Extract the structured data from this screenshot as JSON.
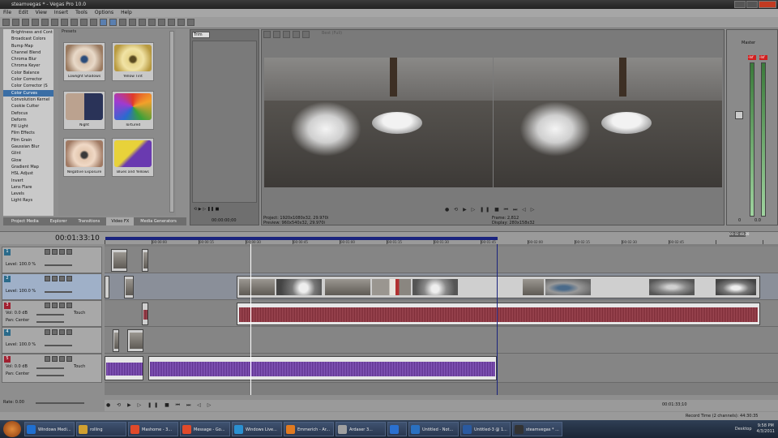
{
  "titlebar": {
    "title": "steamvegas * - Vegas Pro 10.0"
  },
  "menu": [
    "File",
    "Edit",
    "View",
    "Insert",
    "Tools",
    "Options",
    "Help"
  ],
  "fx_list": [
    "Brightness and Cont",
    "Broadcast Colors",
    "Bump Map",
    "Channel Blend",
    "Chroma Blur",
    "Chroma Keyer",
    "Color Balance",
    "Color Corrector",
    "Color Corrector (S",
    "Color Curves",
    "Convolution Kernel",
    "Cookie Cutter",
    "Defocus",
    "Deform",
    "Fill Light",
    "Film Effects",
    "Film Grain",
    "Gaussian Blur",
    "Glint",
    "Glow",
    "Gradient Map",
    "HSL Adjust",
    "Invert",
    "Lens Flare",
    "Levels",
    "Light Rays"
  ],
  "fx_selected_index": 9,
  "presets": {
    "header": "Presets",
    "items": [
      "Lowlight Shadows",
      "Yellow Tint",
      "Night",
      "Tortured",
      "Negative Exposure",
      "Blues and Yellows"
    ]
  },
  "tabs": [
    "Project Media",
    "Explorer",
    "Transitions",
    "Video FX",
    "Media Generators"
  ],
  "active_tab": "Video FX",
  "trimmer": {
    "dropdown": "Trim",
    "time": "00:00:00;00"
  },
  "preview": {
    "mode": "Best (Full)",
    "project_label": "Project:",
    "project_value": "1920x1080x32, 29.970i",
    "preview_label": "Preview:",
    "preview_value": "960x540x32, 29.970i",
    "frame_label": "Frame:",
    "frame_value": "2,812",
    "display_label": "Display:",
    "display_value": "280x158x32"
  },
  "mixer": {
    "title": "Master",
    "values": [
      "-Inf",
      "-Inf"
    ],
    "left_val": "0",
    "right_val": "0.0"
  },
  "timeline": {
    "timecode": "00:01:33:10",
    "ruler": [
      "00:00:00",
      "00:00:15",
      "00:00:30",
      "00:00:45",
      "00:01:00",
      "00:01:15",
      "00:01:30",
      "00:01:45",
      "00:02:00",
      "00:02:15",
      "00:02:30",
      "00:02:45"
    ],
    "tracks": [
      {
        "num": "1",
        "type": "video",
        "level_label": "Level:",
        "level": "100.0 %"
      },
      {
        "num": "2",
        "type": "video",
        "level_label": "Level:",
        "level": "100.0 %"
      },
      {
        "num": "3",
        "type": "audio",
        "vol_label": "Vol:",
        "vol": "0.0 dB",
        "pan_label": "Pan:",
        "pan": "Center",
        "touch": "Touch"
      },
      {
        "num": "4",
        "type": "video",
        "level_label": "Level:",
        "level": "100.0 %"
      },
      {
        "num": "5",
        "type": "audio",
        "vol_label": "Vol:",
        "vol": "0.0 dB",
        "pan_label": "Pan:",
        "pan": "Center",
        "touch": "Touch"
      }
    ],
    "rate_label": "Rate:",
    "rate": "0.00",
    "end_time": "00:01:33;10",
    "record_label": "Record Time (2 channels):",
    "record_time": "44:30:35",
    "status_right": "00:02:48;20"
  },
  "taskbar": {
    "items": [
      "Windows Medi...",
      "rolling",
      "Mashome - 3...",
      "Message - Go...",
      "Windows Live...",
      "Emmerich - Ar...",
      "Ardaser 3...",
      "",
      "Untitled - Not...",
      "Untitled-3 @ 1...",
      "steamvegas * ..."
    ],
    "tray_label": "Desktop",
    "time": "9:58 PM",
    "date": "4/3/2011"
  }
}
